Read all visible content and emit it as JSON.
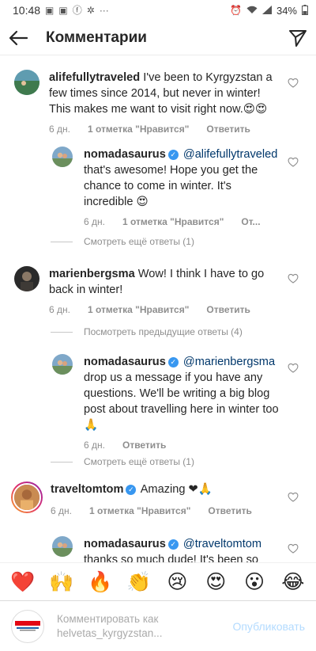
{
  "status_bar": {
    "time": "10:48",
    "battery": "34%",
    "notification_icons": [
      "gallery-icon",
      "gallery-icon",
      "facebook-icon",
      "settings-icon",
      "more-dots-icon"
    ]
  },
  "header": {
    "title": "Комментарии"
  },
  "comments": [
    {
      "username": "alifefullytraveled",
      "text": " I've been to Kyrgyzstan a few times since 2014, but never in winter! This makes me want to visit right now.😍😍",
      "time": "6 дн.",
      "likes": "1 отметка \"Нравится\"",
      "reply": "Ответить",
      "more": "Смотреть ещё ответы (1)",
      "replies": [
        {
          "username": "nomadasaurus",
          "mention": "@alifefullytraveled",
          "text": "that's awesome! Hope you get the chance to come in winter. It's incredible 😍",
          "time": "6 дн.",
          "likes": "1 отметка \"Нравится\"",
          "reply": "От..."
        }
      ]
    },
    {
      "username": "marienbergsma",
      "text": " Wow! I think I have to go back in winter!",
      "time": "6 дн.",
      "likes": "1 отметка \"Нравится\"",
      "reply": "Ответить",
      "previous": "Посмотреть предыдущие ответы (4)",
      "more": "Смотреть ещё ответы (1)",
      "replies": [
        {
          "username": "nomadasaurus",
          "mention": "@marienbergsma",
          "text": "drop us a message if you have any questions. We'll be writing a big blog post about travelling here in winter too 🙏",
          "time": "6 дн.",
          "reply": "Ответить"
        }
      ]
    },
    {
      "username": "traveltomtom",
      "text": " Amazing ❤🙏",
      "time": "6 дн.",
      "likes": "1 отметка \"Нравится\"",
      "reply": "Ответить",
      "replies": [
        {
          "username": "nomadasaurus",
          "mention": "@traveltomtom",
          "text": "thanks so much dude! It's been so"
        }
      ]
    }
  ],
  "quick_emojis": [
    "❤️",
    "🙌",
    "🔥",
    "👏",
    "😢",
    "😍",
    "😮",
    "😂"
  ],
  "composer": {
    "placeholder_line1": "Комментировать как",
    "placeholder_line2": "helvetas_kyrgyzstan...",
    "publish": "Опубликовать"
  },
  "colors": {
    "verified": "#3897f0",
    "publish_disabled": "#b3dbff",
    "meta_gray": "#8e8e8e"
  }
}
